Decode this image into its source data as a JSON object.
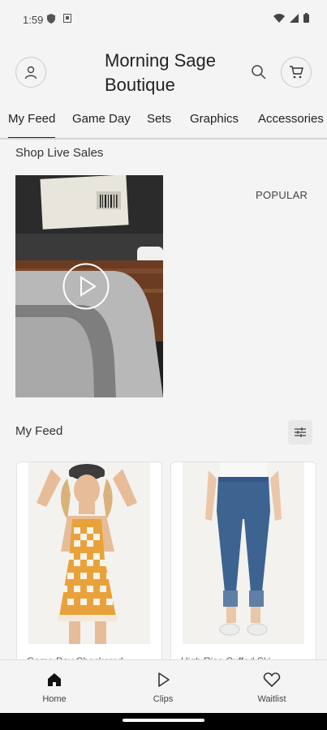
{
  "status_bar": {
    "time": "1:59"
  },
  "header": {
    "shop_name": "Morning Sage Boutique"
  },
  "tabs": [
    {
      "label": "My Feed",
      "active": true
    },
    {
      "label": "Game Day"
    },
    {
      "label": "Sets"
    },
    {
      "label": "Graphics"
    },
    {
      "label": "Accessories"
    }
  ],
  "live_sales": {
    "title": "Shop Live Sales",
    "sort_label": "POPULAR"
  },
  "feed": {
    "title": "My Feed",
    "products": [
      {
        "name": "Game Day Checkered..."
      },
      {
        "name": "High Rise Cuffed Ski..."
      }
    ]
  },
  "bottom_nav": [
    {
      "label": "Home",
      "icon": "home-icon",
      "active": true
    },
    {
      "label": "Clips",
      "icon": "play-icon"
    },
    {
      "label": "Waitlist",
      "icon": "heart-icon"
    }
  ],
  "colors": {
    "accent": "#222222",
    "background": "#f4f4f4",
    "overall_orange": "#e9a23b",
    "denim": "#3d6391"
  }
}
